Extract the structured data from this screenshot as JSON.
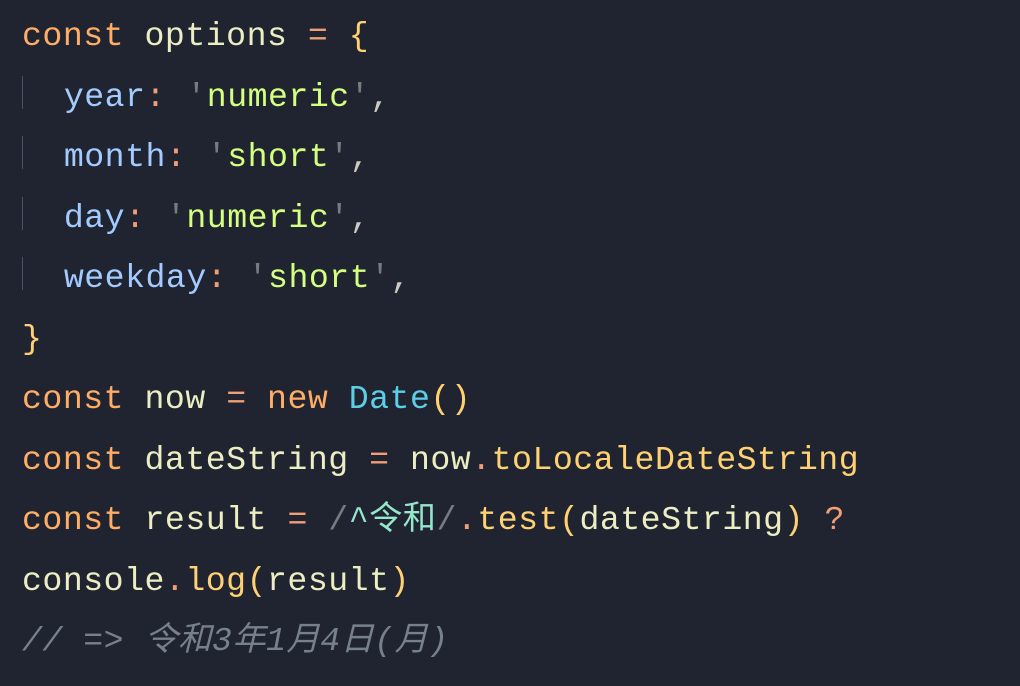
{
  "code": {
    "lines": [
      {
        "id": "l1",
        "tokens": [
          {
            "text": "const",
            "cls": "kw"
          },
          {
            "text": " ",
            "cls": ""
          },
          {
            "text": "options",
            "cls": "var"
          },
          {
            "text": " ",
            "cls": ""
          },
          {
            "text": "=",
            "cls": "op"
          },
          {
            "text": " ",
            "cls": ""
          },
          {
            "text": "{",
            "cls": "brace"
          }
        ]
      },
      {
        "id": "l2",
        "indent": true,
        "tokens": [
          {
            "text": "year",
            "cls": "prop"
          },
          {
            "text": ":",
            "cls": "op"
          },
          {
            "text": " ",
            "cls": ""
          },
          {
            "text": "'",
            "cls": "delim"
          },
          {
            "text": "numeric",
            "cls": "str"
          },
          {
            "text": "'",
            "cls": "delim"
          },
          {
            "text": ",",
            "cls": "punct"
          }
        ]
      },
      {
        "id": "l3",
        "indent": true,
        "tokens": [
          {
            "text": "month",
            "cls": "prop"
          },
          {
            "text": ":",
            "cls": "op"
          },
          {
            "text": " ",
            "cls": ""
          },
          {
            "text": "'",
            "cls": "delim"
          },
          {
            "text": "short",
            "cls": "str"
          },
          {
            "text": "'",
            "cls": "delim"
          },
          {
            "text": ",",
            "cls": "punct"
          }
        ]
      },
      {
        "id": "l4",
        "indent": true,
        "tokens": [
          {
            "text": "day",
            "cls": "prop"
          },
          {
            "text": ":",
            "cls": "op"
          },
          {
            "text": " ",
            "cls": ""
          },
          {
            "text": "'",
            "cls": "delim"
          },
          {
            "text": "numeric",
            "cls": "str"
          },
          {
            "text": "'",
            "cls": "delim"
          },
          {
            "text": ",",
            "cls": "punct"
          }
        ]
      },
      {
        "id": "l5",
        "indent": true,
        "tokens": [
          {
            "text": "weekday",
            "cls": "prop"
          },
          {
            "text": ":",
            "cls": "op"
          },
          {
            "text": " ",
            "cls": ""
          },
          {
            "text": "'",
            "cls": "delim"
          },
          {
            "text": "short",
            "cls": "str"
          },
          {
            "text": "'",
            "cls": "delim"
          },
          {
            "text": ",",
            "cls": "punct"
          }
        ]
      },
      {
        "id": "l6",
        "tokens": [
          {
            "text": "}",
            "cls": "brace"
          }
        ]
      },
      {
        "id": "l7",
        "tokens": [
          {
            "text": "const",
            "cls": "kw"
          },
          {
            "text": " ",
            "cls": ""
          },
          {
            "text": "now",
            "cls": "var"
          },
          {
            "text": " ",
            "cls": ""
          },
          {
            "text": "=",
            "cls": "op"
          },
          {
            "text": " ",
            "cls": ""
          },
          {
            "text": "new",
            "cls": "kw"
          },
          {
            "text": " ",
            "cls": ""
          },
          {
            "text": "Date",
            "cls": "class"
          },
          {
            "text": "(",
            "cls": "paren"
          },
          {
            "text": ")",
            "cls": "paren"
          }
        ]
      },
      {
        "id": "l8",
        "tokens": [
          {
            "text": "const",
            "cls": "kw"
          },
          {
            "text": " ",
            "cls": ""
          },
          {
            "text": "dateString",
            "cls": "var"
          },
          {
            "text": " ",
            "cls": ""
          },
          {
            "text": "=",
            "cls": "op"
          },
          {
            "text": " ",
            "cls": ""
          },
          {
            "text": "now",
            "cls": "var"
          },
          {
            "text": ".",
            "cls": "op"
          },
          {
            "text": "toLocaleDateString",
            "cls": "func"
          }
        ]
      },
      {
        "id": "l9",
        "tokens": [
          {
            "text": "const",
            "cls": "kw"
          },
          {
            "text": " ",
            "cls": ""
          },
          {
            "text": "result",
            "cls": "var"
          },
          {
            "text": " ",
            "cls": ""
          },
          {
            "text": "=",
            "cls": "op"
          },
          {
            "text": " ",
            "cls": ""
          },
          {
            "text": "/",
            "cls": "delim"
          },
          {
            "text": "^令和",
            "cls": "regexc"
          },
          {
            "text": "/",
            "cls": "delim"
          },
          {
            "text": ".",
            "cls": "op"
          },
          {
            "text": "test",
            "cls": "func"
          },
          {
            "text": "(",
            "cls": "paren"
          },
          {
            "text": "dateString",
            "cls": "var"
          },
          {
            "text": ")",
            "cls": "paren"
          },
          {
            "text": " ",
            "cls": ""
          },
          {
            "text": "?",
            "cls": "op"
          }
        ]
      },
      {
        "id": "l10",
        "tokens": [
          {
            "text": "console",
            "cls": "var"
          },
          {
            "text": ".",
            "cls": "op"
          },
          {
            "text": "log",
            "cls": "func"
          },
          {
            "text": "(",
            "cls": "paren"
          },
          {
            "text": "result",
            "cls": "var"
          },
          {
            "text": ")",
            "cls": "paren"
          }
        ]
      },
      {
        "id": "l11",
        "tokens": [
          {
            "text": "// => 令和3年1月4日(月)",
            "cls": "comment"
          }
        ]
      }
    ]
  }
}
